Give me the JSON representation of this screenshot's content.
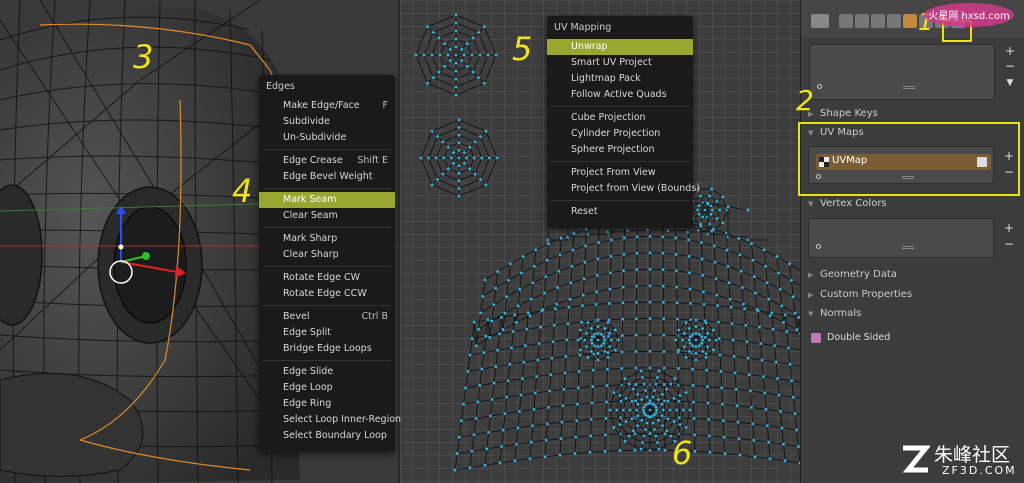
{
  "edges_menu": {
    "title": "Edges",
    "items": [
      {
        "label": "Make Edge/Face",
        "shortcut": "F"
      },
      {
        "label": "Subdivide",
        "shortcut": ""
      },
      {
        "label": "Un-Subdivide",
        "shortcut": ""
      },
      {
        "sep": true
      },
      {
        "label": "Edge Crease",
        "shortcut": "Shift E"
      },
      {
        "label": "Edge Bevel Weight",
        "shortcut": ""
      },
      {
        "sep": true
      },
      {
        "label": "Mark Seam",
        "shortcut": "",
        "active": true
      },
      {
        "label": "Clear Seam",
        "shortcut": ""
      },
      {
        "sep": true
      },
      {
        "label": "Mark Sharp",
        "shortcut": ""
      },
      {
        "label": "Clear Sharp",
        "shortcut": ""
      },
      {
        "sep": true
      },
      {
        "label": "Rotate Edge CW",
        "shortcut": ""
      },
      {
        "label": "Rotate Edge CCW",
        "shortcut": ""
      },
      {
        "sep": true
      },
      {
        "label": "Bevel",
        "shortcut": "Ctrl B"
      },
      {
        "label": "Edge Split",
        "shortcut": ""
      },
      {
        "label": "Bridge Edge Loops",
        "shortcut": ""
      },
      {
        "sep": true
      },
      {
        "label": "Edge Slide",
        "shortcut": ""
      },
      {
        "label": "Edge Loop",
        "shortcut": ""
      },
      {
        "label": "Edge Ring",
        "shortcut": ""
      },
      {
        "label": "Select Loop Inner-Region",
        "shortcut": ""
      },
      {
        "label": "Select Boundary Loop",
        "shortcut": ""
      }
    ]
  },
  "uv_menu": {
    "title": "UV Mapping",
    "items": [
      {
        "label": "Unwrap",
        "active": true
      },
      {
        "label": "Smart UV Project"
      },
      {
        "label": "Lightmap Pack"
      },
      {
        "label": "Follow Active Quads"
      },
      {
        "sep": true
      },
      {
        "label": "Cube Projection"
      },
      {
        "label": "Cylinder Projection"
      },
      {
        "label": "Sphere Projection"
      },
      {
        "sep": true
      },
      {
        "label": "Project From View"
      },
      {
        "label": "Project from View (Bounds)"
      },
      {
        "sep": true
      },
      {
        "label": "Reset"
      }
    ]
  },
  "properties": {
    "shape_keys": "Shape Keys",
    "uv_maps": "UV Maps",
    "uv_map_name": "UVMap",
    "vertex_colors": "Vertex Colors",
    "geometry_data": "Geometry Data",
    "custom_properties": "Custom Properties",
    "normals": "Normals",
    "double_sided": "Double Sided",
    "add": "+",
    "remove": "−"
  },
  "annotations": {
    "n1": "1",
    "n2": "2",
    "n3": "3",
    "n4": "4",
    "n5": "5",
    "n6": "6"
  },
  "watermarks": {
    "top_logo": "火星网 hxsd.com",
    "bottom_logo_cn": "朱峰社区",
    "bottom_logo_en": "ZF3D.COM"
  },
  "colors": {
    "accent_highlight": "#9aa72e",
    "annotation_yellow": "#f0e21c",
    "uv_vertex": "#2fb7e8",
    "uvmap_row": "#7a5c36"
  }
}
